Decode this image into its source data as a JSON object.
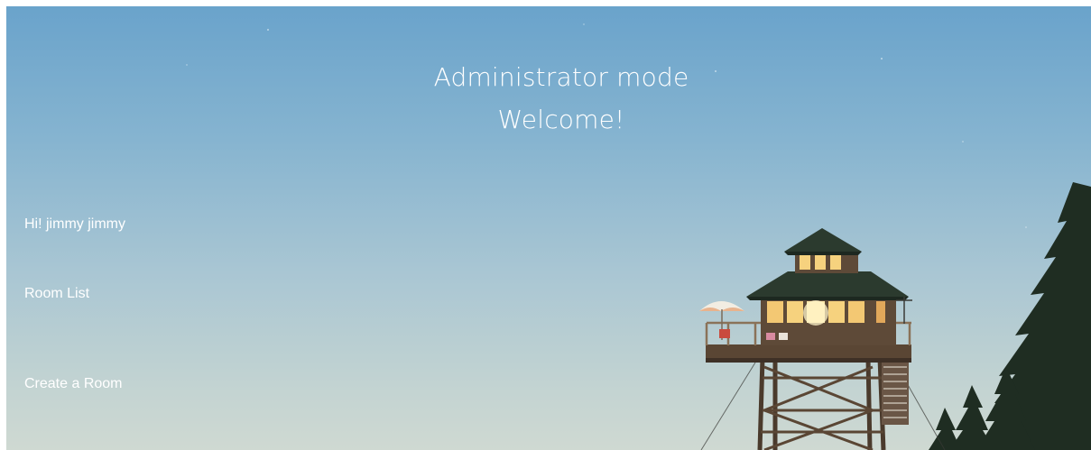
{
  "header": {
    "mode_title": "Administrator mode",
    "welcome": "Welcome!"
  },
  "user": {
    "greeting": "Hi! jimmy jimmy"
  },
  "nav": {
    "room_list": "Room List",
    "create_room": "Create a Room"
  },
  "colors": {
    "text": "#ffffff",
    "sky_top": "#6aa3cb",
    "sky_bottom": "#cfd9d2"
  }
}
